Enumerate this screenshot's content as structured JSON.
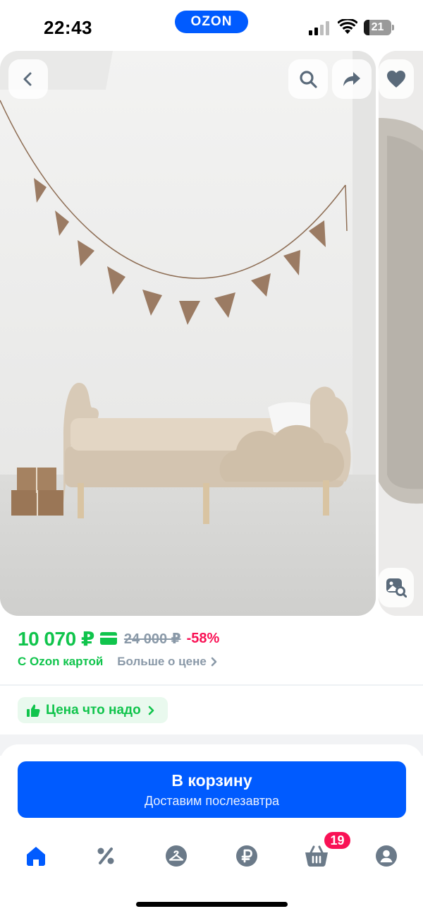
{
  "status_bar": {
    "time": "22:43",
    "brand": "OZON",
    "battery_level": "21",
    "battery_fraction": 0.21
  },
  "gallery": {
    "buttons": [
      {
        "name": "back",
        "icon": "chevron-left-icon"
      },
      {
        "name": "search",
        "icon": "search-icon"
      },
      {
        "name": "share",
        "icon": "share-icon"
      },
      {
        "name": "favorite",
        "icon": "heart-icon"
      },
      {
        "name": "visual-search",
        "icon": "image-search-icon"
      }
    ]
  },
  "price": {
    "current": "10 070 ₽",
    "old": "24 000 ₽",
    "discount": "-58%",
    "ozon_card_label": "С Ozon картой",
    "more_link": "Больше о цене"
  },
  "tag": {
    "label": "Цена что надо"
  },
  "cart": {
    "title": "В корзину",
    "subtitle": "Доставим послезавтра"
  },
  "tabs": [
    {
      "name": "home",
      "icon": "home-icon",
      "active": true
    },
    {
      "name": "promo",
      "icon": "percent-icon",
      "active": false
    },
    {
      "name": "fashion",
      "icon": "hanger-icon",
      "active": false
    },
    {
      "name": "finance",
      "icon": "ruble-icon",
      "active": false
    },
    {
      "name": "cart",
      "icon": "basket-icon",
      "active": false,
      "badge": "19"
    },
    {
      "name": "profile",
      "icon": "user-icon",
      "active": false
    }
  ],
  "colors": {
    "brand_blue": "#005bff",
    "price_green": "#10c44c",
    "discount_pink": "#f91155",
    "muted_gray": "#8a99a8"
  }
}
